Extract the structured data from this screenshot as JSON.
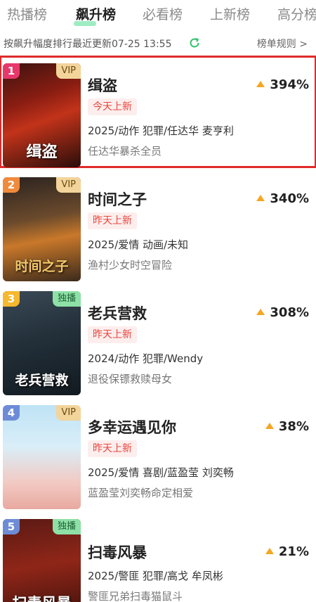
{
  "tabs": [
    {
      "label": "热播榜",
      "active": false
    },
    {
      "label": "飙升榜",
      "active": true
    },
    {
      "label": "必看榜",
      "active": false
    },
    {
      "label": "上新榜",
      "active": false
    },
    {
      "label": "高分榜",
      "active": false
    }
  ],
  "subbar": {
    "description": "按飙升幅度排行最近更新07-25 13:55",
    "rules_label": "榜单规则 >",
    "refresh_icon": "refresh-icon"
  },
  "colors": {
    "accent_green": "#2ec26b",
    "highlight_red": "#e02a2a",
    "rank_colors": [
      "#e8386b",
      "#f08a3c",
      "#f5b82e",
      "#6e8cd6",
      "#6e8cd6"
    ],
    "arrow_orange": "#f5a623"
  },
  "items": [
    {
      "rank": "1",
      "tag": "VIP",
      "title": "缉盗",
      "poster_title": "缉盗",
      "increase": "394%",
      "new_tag": "今天上新",
      "meta": "2025/动作 犯罪/任达华 麦亨利",
      "desc": "任达华暴杀全员",
      "selected": true
    },
    {
      "rank": "2",
      "tag": "VIP",
      "title": "时间之子",
      "poster_title": "时间之子",
      "increase": "340%",
      "new_tag": "昨天上新",
      "meta": "2025/爱情 动画/未知",
      "desc": "渔村少女时空冒险",
      "selected": false
    },
    {
      "rank": "3",
      "tag": "独播",
      "title": "老兵营救",
      "poster_title": "老兵营救",
      "increase": "308%",
      "new_tag": "昨天上新",
      "meta": "2024/动作 犯罪/Wendy",
      "desc": "退役保镖救赎母女",
      "selected": false
    },
    {
      "rank": "4",
      "tag": "VIP",
      "title": "多幸运遇见你",
      "poster_title": "",
      "increase": "38%",
      "new_tag": "昨天上新",
      "meta": "2025/爱情 喜剧/蓝盈莹 刘奕畅",
      "desc": "蓝盈莹刘奕畅命定相爱",
      "selected": false
    },
    {
      "rank": "5",
      "tag": "独播",
      "title": "扫毒风暴",
      "poster_title": "扫毒风暴",
      "increase": "21%",
      "new_tag": "",
      "meta": "2025/警匪 犯罪/高戈 牟凤彬",
      "desc": "警匪兄弟扫毒猫鼠斗",
      "selected": false
    }
  ]
}
